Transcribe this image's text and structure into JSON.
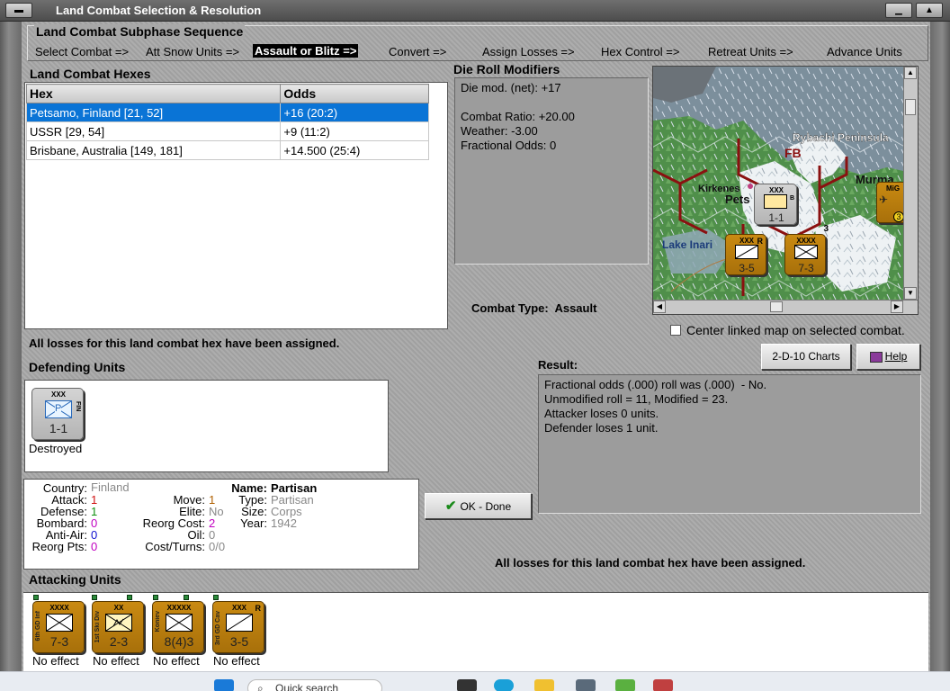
{
  "window": {
    "title": "Land Combat Selection & Resolution"
  },
  "subphase": {
    "title": "Land Combat Subphase Sequence",
    "steps": [
      "Select Combat =>",
      "Att Snow Units =>",
      "Assault or Blitz =>",
      "Convert =>",
      "Assign Losses =>",
      "Hex Control =>",
      "Retreat Units =>",
      "Advance Units"
    ],
    "active_index": 2
  },
  "hexes": {
    "label": "Land Combat Hexes",
    "columns": [
      "Hex",
      "Odds"
    ],
    "rows": [
      {
        "hex": "Petsamo, Finland [21, 52]",
        "odds": "+16 (20:2)",
        "selected": true
      },
      {
        "hex": "USSR [29, 54]",
        "odds": "+9 (11:2)",
        "selected": false
      },
      {
        "hex": "Brisbane, Australia [149, 181]",
        "odds": "+14.500 (25:4)",
        "selected": false
      }
    ]
  },
  "die_roll": {
    "label": "Die Roll Modifiers",
    "net": "Die mod. (net): +17",
    "combat_ratio": "Combat Ratio: +20.00",
    "weather": "Weather: -3.00",
    "fractional": "Fractional Odds: 0"
  },
  "combat_type": "Combat Type:  Assault",
  "map": {
    "labels": {
      "rybachi": "Rybachi Peninsula",
      "fb": "FB",
      "kirkenes": "Kirkenes",
      "pets": "Pets",
      "murmansk": "Murma",
      "lake": "Lake Inari",
      "mig": "MiG"
    },
    "center_checkbox": "Center linked map on selected combat."
  },
  "losses_assigned_msg": "All losses for this land combat hex have been assigned.",
  "buttons": {
    "charts": "2-D-10 Charts",
    "help": "Help",
    "ok": "OK - Done"
  },
  "defending": {
    "label": "Defending Units",
    "units": [
      {
        "size": "XXX",
        "str": "1-1",
        "nation": "FIN",
        "letter": "P",
        "status": "Destroyed"
      }
    ]
  },
  "unit_info": {
    "country_l": "Country:",
    "country": "Finland",
    "attack_l": "Attack:",
    "attack": "1",
    "defense_l": "Defense:",
    "defense": "1",
    "bombard_l": "Bombard:",
    "bombard": "0",
    "antiair_l": "Anti-Air:",
    "antiair": "0",
    "reorgpts_l": "Reorg Pts:",
    "reorgpts": "0",
    "move_l": "Move:",
    "move": "1",
    "elite_l": "Elite:",
    "elite": "No",
    "reorgcost_l": "Reorg Cost:",
    "reorgcost": "2",
    "oil_l": "Oil:",
    "oil": "0",
    "costturns_l": "Cost/Turns:",
    "costturns": "0/0",
    "name_l": "Name:",
    "name": "Partisan",
    "type_l": "Type:",
    "type": "Partisan",
    "size_l": "Size:",
    "size": "Corps",
    "year_l": "Year:",
    "year": "1942"
  },
  "result": {
    "label": "Result:",
    "lines": [
      "Fractional odds (.000) roll was (.000)  - No.",
      "Unmodified roll = 11, Modified = 23.",
      "Attacker loses 0 units.",
      "Defender loses 1 unit."
    ]
  },
  "attacking": {
    "label": "Attacking Units",
    "units": [
      {
        "size": "XXXX",
        "str": "7-3",
        "side": "6th GD Inf",
        "status": "No effect",
        "kind": "inf",
        "r": ""
      },
      {
        "size": "XX",
        "str": "2-3",
        "side": "1st Ski Div",
        "status": "No effect",
        "kind": "ski",
        "r": ""
      },
      {
        "size": "XXXXX",
        "str": "8(4)3",
        "side": "Koniev",
        "status": "No effect",
        "kind": "inf",
        "r": ""
      },
      {
        "size": "XXX",
        "str": "3-5",
        "side": "3rd GD Cav",
        "status": "No effect",
        "kind": "cav",
        "r": "R"
      }
    ]
  },
  "map_counters": {
    "top": {
      "size": "XXX",
      "str": "1-1",
      "badge": "B"
    },
    "left": {
      "size": "XXX",
      "str": "3-5",
      "r": "R"
    },
    "right": {
      "size": "XXXX",
      "str": "7-3",
      "badge": "3"
    },
    "mig_badge": "3"
  },
  "taskbar": {
    "search": "Quick search"
  },
  "colors": {
    "selected_row": "#0a74d6",
    "counter_soviet": "#b87a0e",
    "counter_finland": "#c4c4c4",
    "hex_border": "#8a1010"
  }
}
